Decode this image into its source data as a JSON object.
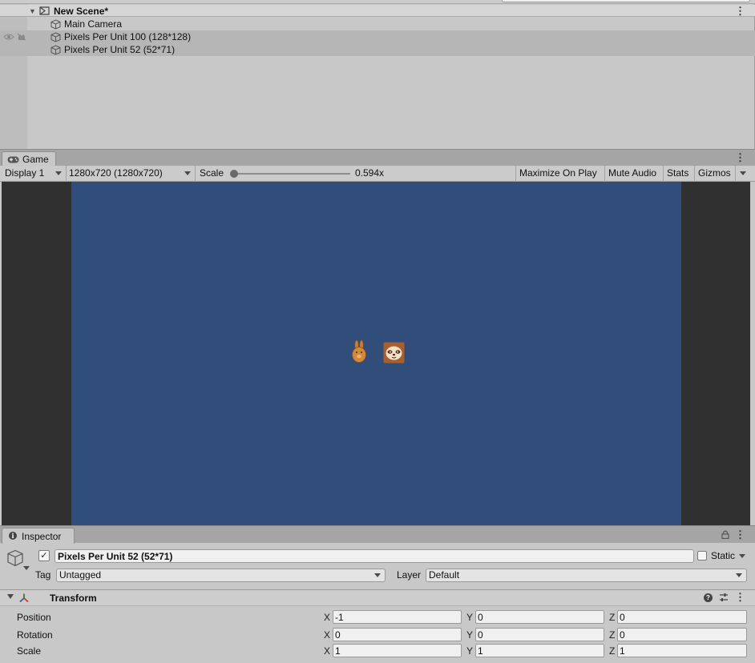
{
  "hierarchy": {
    "scene_name": "New Scene*",
    "objects": [
      {
        "label": "Main Camera"
      },
      {
        "label": "Pixels Per Unit 100 (128*128)"
      },
      {
        "label": "Pixels Per Unit 52 (52*71)"
      }
    ],
    "menu_glyph": "⋮"
  },
  "game": {
    "tab_label": "Game",
    "menu_glyph": "⋮",
    "toolbar": {
      "display": "Display 1",
      "resolution": "1280x720 (1280x720)",
      "scale_label": "Scale",
      "scale_value": "0.594x",
      "maximize_on_play": "Maximize On Play",
      "mute_audio": "Mute Audio",
      "stats": "Stats",
      "gizmos": "Gizmos"
    },
    "colors": {
      "canvas_bg": "#314d79",
      "letterbox": "#303030"
    }
  },
  "inspector": {
    "tab_label": "Inspector",
    "menu_glyph": "⋮",
    "object": {
      "active_check": "✓",
      "name": "Pixels Per Unit 52 (52*71)",
      "static_label": "Static",
      "tag_label": "Tag",
      "tag_value": "Untagged",
      "layer_label": "Layer",
      "layer_value": "Default"
    },
    "transform": {
      "title": "Transform",
      "help_glyph": "?",
      "menu_glyph": "⋮",
      "rows": {
        "position": {
          "label": "Position",
          "x": "-1",
          "y": "0",
          "z": "0"
        },
        "rotation": {
          "label": "Rotation",
          "x": "0",
          "y": "0",
          "z": "0"
        },
        "scale": {
          "label": "Scale",
          "x": "1",
          "y": "1",
          "z": "1"
        }
      },
      "axis": {
        "x": "X",
        "y": "Y",
        "z": "Z"
      }
    }
  },
  "icons": [
    "scene-icon",
    "gameobject-cube-icon",
    "eye-icon",
    "hand-icon",
    "gamepad-icon",
    "info-icon",
    "lock-icon",
    "transform-icon",
    "help-icon",
    "presets-icon",
    "kebab-menu-icon",
    "bunny-sprite",
    "sloth-sprite"
  ]
}
